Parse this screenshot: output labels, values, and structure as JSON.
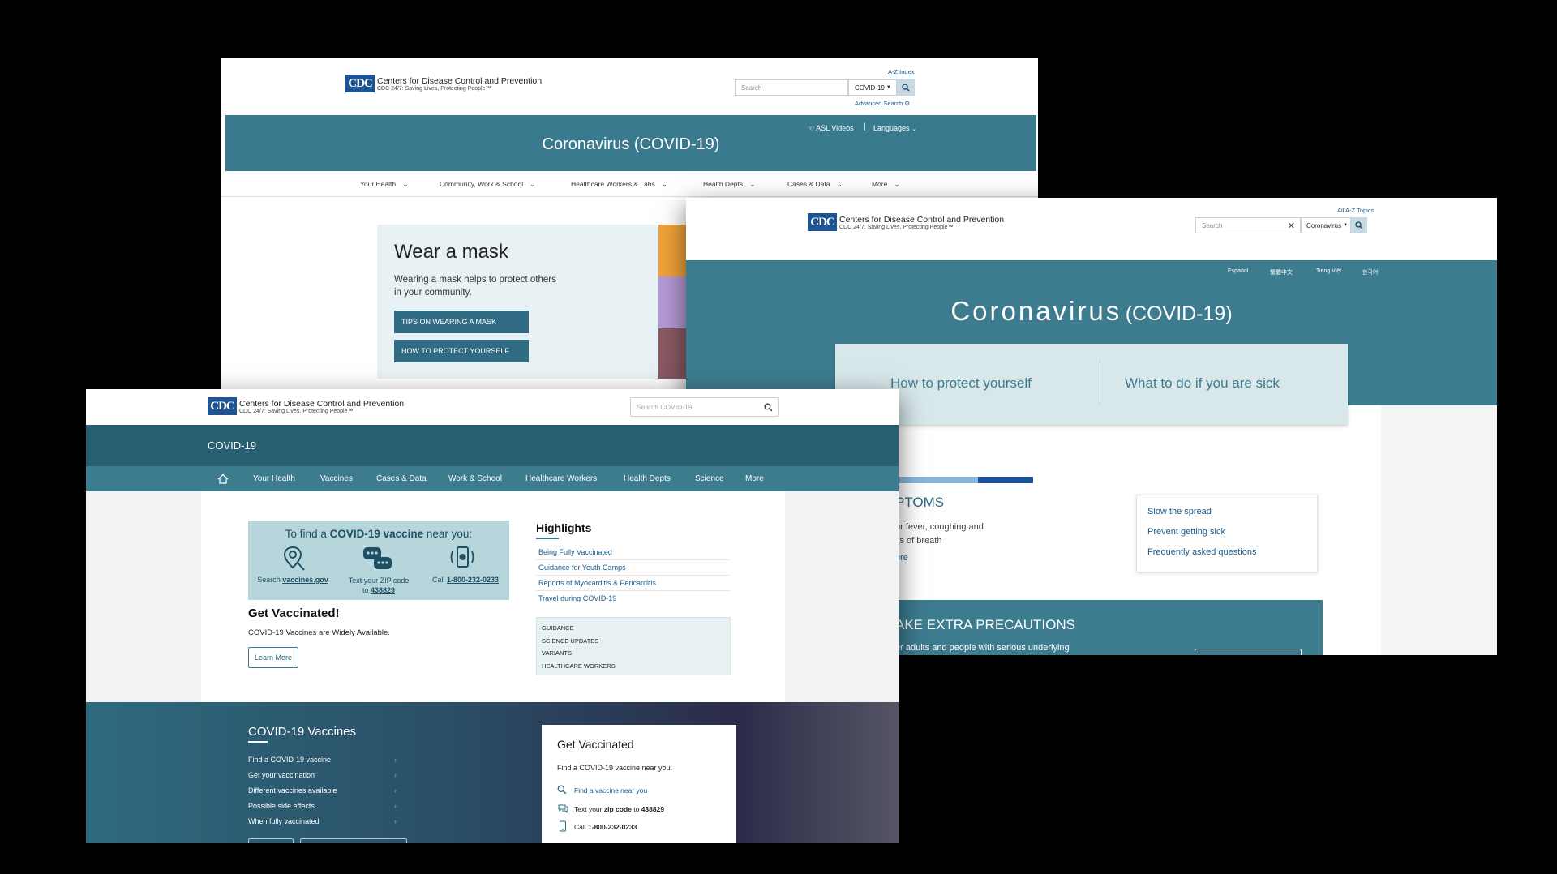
{
  "cdc": {
    "logo_text": "CDC",
    "name": "Centers for Disease Control and Prevention",
    "tagline": "CDC 24/7: Saving Lives, Protecting People™"
  },
  "shot1": {
    "az_link": "A-Z Index",
    "search_placeholder": "Search",
    "scope": "COVID-19",
    "advanced_search": "Advanced Search",
    "asl": "ASL Videos",
    "languages": "Languages",
    "banner_title": "Coronavirus (COVID-19)",
    "nav": [
      "Your Health",
      "Community, Work & School",
      "Healthcare Workers & Labs",
      "Health Depts",
      "Cases & Data",
      "More"
    ],
    "hero_title": "Wear a mask",
    "hero_text": "Wearing a mask helps to protect others in your community.",
    "btn1": "TIPS ON WEARING A MASK",
    "btn2": "HOW TO PROTECT YOURSELF",
    "accent_colors": [
      "#f0a23a",
      "#b59ad6",
      "#8a5a63"
    ]
  },
  "shot2": {
    "az_link": "All A-Z Topics",
    "search_placeholder": "Search",
    "scope": "Coronavirus",
    "langs": [
      "Español",
      "繁體中文",
      "Tiếng Việt",
      "한국어"
    ],
    "title_main": "Coronavirus",
    "title_sub": "(COVID-19)",
    "tab1": "How to protect yourself",
    "tab2": "What to do if you are sick",
    "symptoms_heading": "PTOMS",
    "symptoms_text1": "or fever, coughing and",
    "symptoms_text2": "ss of breath",
    "symptoms_more": "ore",
    "quick_links": [
      "Slow the spread",
      "Prevent getting sick",
      "Frequently asked questions"
    ],
    "precautions_heading": "AKE EXTRA PRECAUTIONS",
    "precautions_text": "er adults and people with serious underlying"
  },
  "shot3": {
    "search_placeholder": "Search COVID-19",
    "header_title": "COVID-19",
    "nav": [
      "Your Health",
      "Vaccines",
      "Cases & Data",
      "Work & School",
      "Healthcare Workers",
      "Health Depts",
      "Science",
      "More"
    ],
    "promo_title_pre": "To find a ",
    "promo_title_bold": "COVID-19 vaccine",
    "promo_title_post": " near you:",
    "promo_items": [
      {
        "pre": "Search ",
        "bold": "vaccines.gov",
        "line2": ""
      },
      {
        "pre": "Text your ZIP code",
        "bold": "438829",
        "line2": "to "
      },
      {
        "pre": "Call ",
        "bold": "1-800-232-0233",
        "line2": ""
      }
    ],
    "get_vaccinated_title": "Get Vaccinated!",
    "get_vaccinated_text": "COVID-19 Vaccines are Widely Available.",
    "learn_more": "Learn More",
    "highlights_title": "Highlights",
    "highlights": [
      "Being Fully Vaccinated",
      "Guidance for Youth Camps",
      "Reports of Myocarditis & Pericarditis",
      "Travel during COVID-19"
    ],
    "categories": [
      "GUIDANCE",
      "SCIENCE UPDATES",
      "VARIANTS",
      "HEALTHCARE WORKERS"
    ],
    "vaccines_title": "COVID-19 Vaccines",
    "vaccine_links": [
      "Find a COVID-19 vaccine",
      "Get your vaccination",
      "Different vaccines available",
      "Possible side effects",
      "When fully vaccinated"
    ],
    "card_title": "Get Vaccinated",
    "card_text": "Find a COVID-19 vaccine near you.",
    "card_link": "Find a vaccine near you",
    "card_text_pre": "Text your ",
    "card_text_bold": "zip code",
    "card_text_mid": " to ",
    "card_text_num": "438829",
    "card_call_pre": "Call ",
    "card_call_num": "1-800-232-0233"
  }
}
